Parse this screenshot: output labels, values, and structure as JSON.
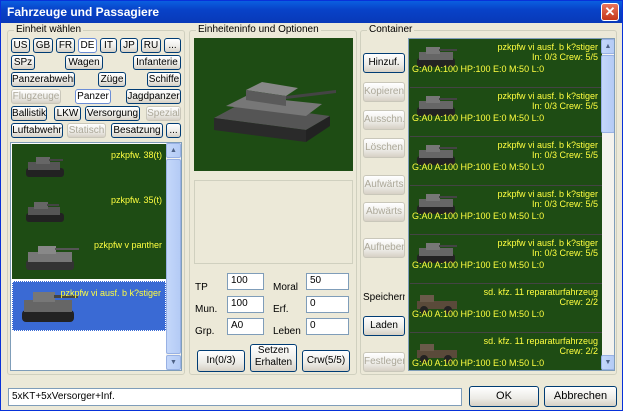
{
  "window": {
    "title": "Fahrzeuge und Passagiere"
  },
  "unit_select": {
    "label": "Einheit wählen",
    "nations": [
      "US",
      "GB",
      "FR",
      "DE",
      "IT",
      "JP",
      "RU",
      "..."
    ],
    "selected_nation": "DE",
    "row2": [
      "SPz",
      "Wagen",
      "Infanterie"
    ],
    "row3": [
      "Panzerabwehr",
      "Züge",
      "Schiffe"
    ],
    "row4": [
      "Flugzeuge",
      "Panzer",
      "Jagdpanzer"
    ],
    "row5": [
      "Ballistik",
      "LKW",
      "Versorgung",
      "Spezial"
    ],
    "row6": [
      "Luftabwehr",
      "Statisch",
      "Besatzung",
      "..."
    ],
    "units": [
      {
        "name": "pzkpfw. 38(t)"
      },
      {
        "name": "pzkpfw. 35(t)"
      },
      {
        "name": "pzkpfw v panther"
      },
      {
        "name": "pzkpfw vi ausf. b k?stiger"
      }
    ]
  },
  "unit_info": {
    "label": "Einheiteninfo und Optionen",
    "tp_label": "TP",
    "tp_value": "100",
    "moral_label": "Moral",
    "moral_value": "50",
    "mun_label": "Mun.",
    "mun_value": "100",
    "erf_label": "Erf.",
    "erf_value": "0",
    "grp_label": "Grp.",
    "grp_value": "A0",
    "leben_label": "Leben",
    "leben_value": "0",
    "btn_in": "In(0/3)",
    "btn_setzen": "Setzen Erhalten",
    "btn_crw": "Crw(5/5)"
  },
  "container": {
    "label": "Container",
    "buttons": [
      "Hinzuf.",
      "Kopieren",
      "Ausschn.",
      "Löschen",
      "Aufwärts",
      "Abwärts",
      "Aufheben",
      "Speichern",
      "Laden",
      "Festlegen"
    ],
    "items": [
      {
        "l1": "pzkpfw vi ausf. b k?stiger",
        "l2": "In: 0/3 Crew: 5/5",
        "l3": "G:A0 A:100 HP:100 E:0 M:50 L:0"
      },
      {
        "l1": "pzkpfw vi ausf. b k?stiger",
        "l2": "In: 0/3 Crew: 5/5",
        "l3": "G:A0 A:100 HP:100 E:0 M:50 L:0"
      },
      {
        "l1": "pzkpfw vi ausf. b k?stiger",
        "l2": "In: 0/3 Crew: 5/5",
        "l3": "G:A0 A:100 HP:100 E:0 M:50 L:0"
      },
      {
        "l1": "pzkpfw vi ausf. b k?stiger",
        "l2": "In: 0/3 Crew: 5/5",
        "l3": "G:A0 A:100 HP:100 E:0 M:50 L:0"
      },
      {
        "l1": "pzkpfw vi ausf. b k?stiger",
        "l2": "In: 0/3 Crew: 5/5",
        "l3": "G:A0 A:100 HP:100 E:0 M:50 L:0"
      },
      {
        "l1": "sd. kfz. 11 reparaturfahrzeug",
        "l2": "Crew: 2/2",
        "l3": "G:A0 A:100 HP:100 E:0 M:50 L:0"
      },
      {
        "l1": "sd. kfz. 11 reparaturfahrzeug",
        "l2": "Crew: 2/2",
        "l3": "G:A0 A:100 HP:100 E:0 M:50 L:0"
      }
    ]
  },
  "footer": {
    "summary": "5xKT+5xVersorger+Inf.",
    "ok": "OK",
    "cancel": "Abbrechen"
  }
}
